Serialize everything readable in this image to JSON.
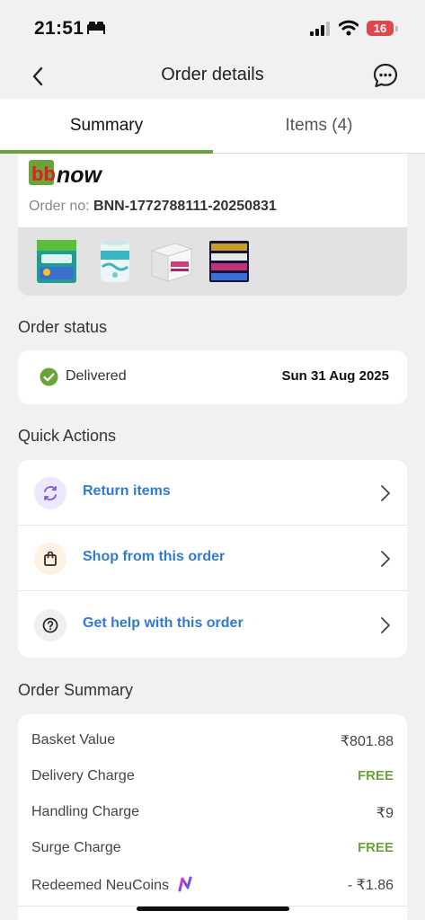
{
  "status_bar": {
    "time": "21:51",
    "battery": "16"
  },
  "header": {
    "title": "Order details"
  },
  "tabs": [
    {
      "label": "Summary",
      "active": true
    },
    {
      "label": "Items (4)",
      "active": false
    }
  ],
  "order": {
    "brand_logo_text": "bbnow",
    "order_no_label": "Order no:",
    "order_no": "BNN-1772788111-20250831",
    "thumbnails": [
      "stayfree-pads",
      "origami-kitchen-towel",
      "origami-klassic-tissue",
      "premier-tissue-pack"
    ]
  },
  "order_status": {
    "section_title": "Order status",
    "status": "Delivered",
    "date": "Sun 31 Aug 2025"
  },
  "quick_actions": {
    "section_title": "Quick Actions",
    "items": [
      {
        "label": "Return items",
        "icon": "return-icon"
      },
      {
        "label": "Shop from this order",
        "icon": "shopping-bag-icon"
      },
      {
        "label": "Get help with this order",
        "icon": "help-icon"
      }
    ]
  },
  "order_summary": {
    "section_title": "Order Summary",
    "rows": [
      {
        "label": "Basket Value",
        "value": "₹801.88"
      },
      {
        "label": "Delivery Charge",
        "value": "FREE"
      },
      {
        "label": "Handling Charge",
        "value": "₹9"
      },
      {
        "label": "Surge Charge",
        "value": "FREE"
      },
      {
        "label": "Redeemed NeuCoins",
        "value": "- ₹1.86"
      }
    ]
  },
  "colors": {
    "accent_green": "#6aa339",
    "link_blue": "#2f7bd1",
    "bb_red": "#e31b23"
  }
}
